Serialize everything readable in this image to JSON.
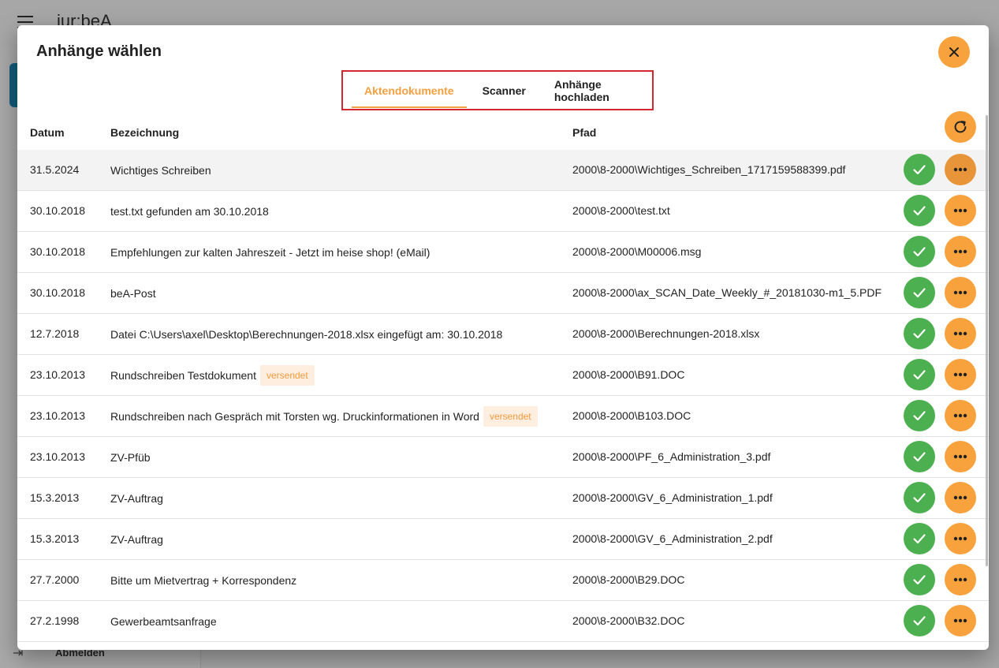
{
  "background": {
    "app_title": "jur:beA",
    "logout_label": "Abmelden"
  },
  "dialog": {
    "title": "Anhänge wählen",
    "tabs": [
      {
        "label": "Aktendokumente",
        "active": true
      },
      {
        "label": "Scanner",
        "active": false
      },
      {
        "label": "Anhänge hochladen",
        "active": false
      }
    ],
    "columns": {
      "date": "Datum",
      "name": "Bezeichnung",
      "path": "Pfad"
    },
    "rows": [
      {
        "date": "31.5.2024",
        "name": "Wichtiges Schreiben",
        "badge": "",
        "path": "2000\\8-2000\\Wichtiges_Schreiben_1717159588399.pdf"
      },
      {
        "date": "30.10.2018",
        "name": "test.txt gefunden am 30.10.2018",
        "badge": "",
        "path": "2000\\8-2000\\test.txt"
      },
      {
        "date": "30.10.2018",
        "name": "Empfehlungen zur kalten Jahreszeit - Jetzt im heise shop! (eMail)",
        "badge": "",
        "path": "2000\\8-2000\\M00006.msg"
      },
      {
        "date": "30.10.2018",
        "name": "beA-Post",
        "badge": "",
        "path": "2000\\8-2000\\ax_SCAN_Date_Weekly_#_20181030-m1_5.PDF"
      },
      {
        "date": "12.7.2018",
        "name": "Datei C:\\Users\\axel\\Desktop\\Berechnungen-2018.xlsx eingefügt am: 30.10.2018",
        "badge": "",
        "path": "2000\\8-2000\\Berechnungen-2018.xlsx"
      },
      {
        "date": "23.10.2013",
        "name": "Rundschreiben Testdokument",
        "badge": "versendet",
        "path": "2000\\8-2000\\B91.DOC"
      },
      {
        "date": "23.10.2013",
        "name": "Rundschreiben nach Gespräch mit Torsten wg. Druckinformationen in Word",
        "badge": "versendet",
        "path": "2000\\8-2000\\B103.DOC"
      },
      {
        "date": "23.10.2013",
        "name": "ZV-Pfüb",
        "badge": "",
        "path": "2000\\8-2000\\PF_6_Administration_3.pdf"
      },
      {
        "date": "15.3.2013",
        "name": "ZV-Auftrag",
        "badge": "",
        "path": "2000\\8-2000\\GV_6_Administration_1.pdf"
      },
      {
        "date": "15.3.2013",
        "name": "ZV-Auftrag",
        "badge": "",
        "path": "2000\\8-2000\\GV_6_Administration_2.pdf"
      },
      {
        "date": "27.7.2000",
        "name": "Bitte um Mietvertrag + Korrespondenz",
        "badge": "",
        "path": "2000\\8-2000\\B29.DOC"
      },
      {
        "date": "27.2.1998",
        "name": "Gewerbeamtsanfrage",
        "badge": "",
        "path": "2000\\8-2000\\B32.DOC"
      }
    ]
  },
  "colors": {
    "accent": "#f7a23d",
    "success": "#4caf50",
    "highlight_border": "#d3262f"
  },
  "icons": {
    "close": "close-icon",
    "refresh": "refresh-icon",
    "select": "check-icon",
    "more": "more-horiz-icon"
  }
}
